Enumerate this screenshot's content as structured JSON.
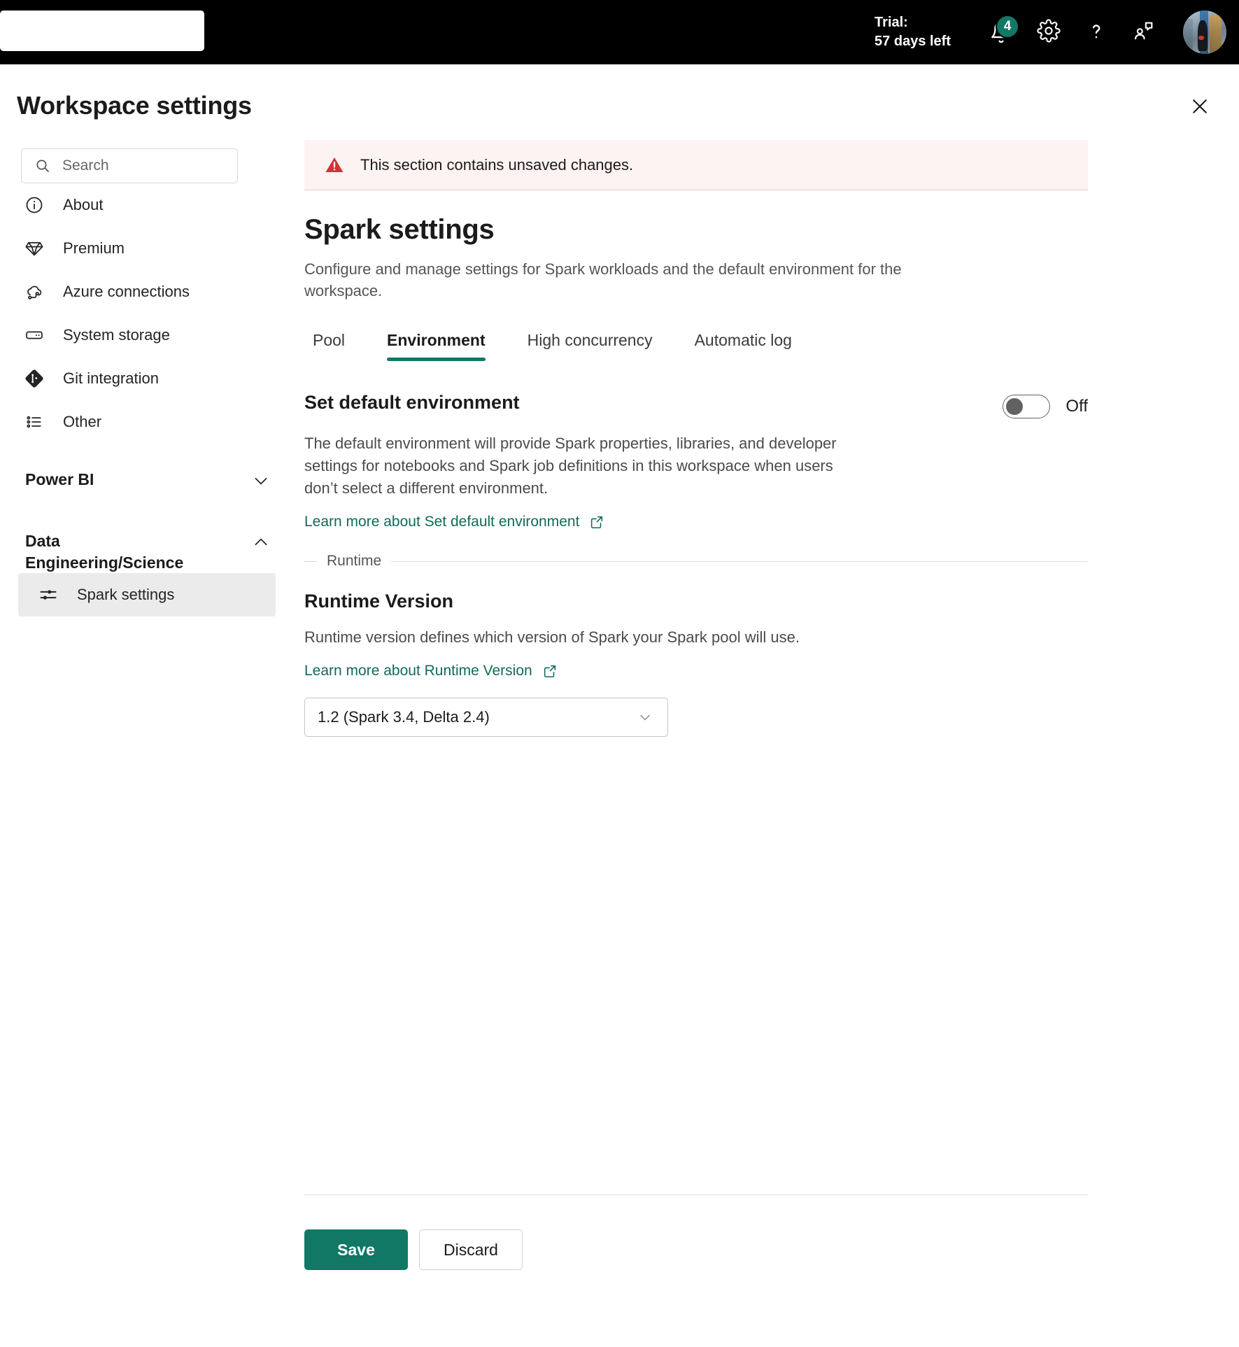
{
  "topbar": {
    "search_placeholder": "",
    "trial_label": "Trial:",
    "trial_days": "57 days left",
    "notification_count": "4",
    "icons": {
      "bell": "bell-icon",
      "gear": "gear-icon",
      "help": "question-mark-icon",
      "feedback": "feedback-icon",
      "avatar": "user-avatar"
    }
  },
  "panel": {
    "title": "Workspace settings",
    "close_label": "Close"
  },
  "sidebar": {
    "search_placeholder": "Search",
    "items": [
      {
        "label": "About",
        "icon": "info-circle-icon"
      },
      {
        "label": "Premium",
        "icon": "diamond-icon"
      },
      {
        "label": "Azure connections",
        "icon": "cloud-link-icon"
      },
      {
        "label": "System storage",
        "icon": "storage-icon"
      },
      {
        "label": "Git integration",
        "icon": "git-icon"
      },
      {
        "label": "Other",
        "icon": "list-icon"
      }
    ],
    "groups": [
      {
        "label": "Power BI",
        "expanded": false,
        "chevron": "chevron-down-icon",
        "items": []
      },
      {
        "label": "Data Engineering/Science",
        "expanded": true,
        "chevron": "chevron-up-icon",
        "items": [
          {
            "label": "Spark settings",
            "icon": "sliders-icon",
            "selected": true
          }
        ]
      }
    ]
  },
  "content": {
    "banner": {
      "text": "This section contains unsaved changes.",
      "icon": "warning-triangle-icon",
      "bg_color": "#fdf3f2",
      "icon_color": "#d13438"
    },
    "heading": "Spark settings",
    "description": "Configure and manage settings for Spark workloads and the default environment for the workspace.",
    "tabs": [
      {
        "label": "Pool",
        "active": false
      },
      {
        "label": "Environment",
        "active": true
      },
      {
        "label": "High concurrency",
        "active": false
      },
      {
        "label": "Automatic log",
        "active": false
      }
    ],
    "accent_color": "#117865",
    "default_environment": {
      "title": "Set default environment",
      "toggle_state": "Off",
      "description": "The default environment will provide Spark properties, libraries, and developer settings for notebooks and Spark job definitions in this workspace when users don’t select a different environment.",
      "learn_more": "Learn more about Set default environment",
      "learn_more_icon": "external-link-icon"
    },
    "runtime_divider_label": "Runtime",
    "runtime": {
      "title": "Runtime Version",
      "description": "Runtime version defines which version of Spark your Spark pool will use.",
      "learn_more": "Learn more about Runtime Version",
      "learn_more_icon": "external-link-icon",
      "selected_value": "1.2 (Spark 3.4, Delta 2.4)",
      "chevron": "chevron-down-icon"
    }
  },
  "footer": {
    "save_label": "Save",
    "discard_label": "Discard"
  }
}
